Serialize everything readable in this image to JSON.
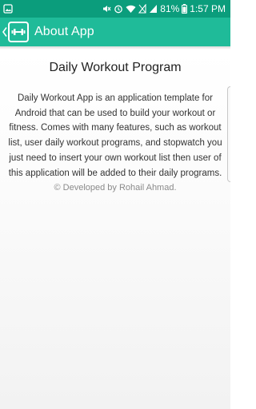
{
  "status_bar": {
    "battery_percent": "81%",
    "time": "1:57 PM",
    "icons": [
      "gallery-notification-icon",
      "mute-icon",
      "alarm-icon",
      "wifi-icon",
      "silent-signal-icon",
      "cellular-signal-icon",
      "battery-icon"
    ]
  },
  "app_bar": {
    "title": "About App",
    "icon": "dumbbell-icon",
    "background": "#1fbb99"
  },
  "content": {
    "title": "Daily Workout Program",
    "description": "Daily Workout App is an application template for Android that can be used to build your workout or fitness. Comes with many features, such as workout list, user daily workout programs, and stopwatch you just need to insert your own workout list then user of this application will be added to their daily programs.",
    "credit": "© Developed by Rohail Ahmad."
  },
  "colors": {
    "status_bar": "#0b9d7c",
    "accent": "#1fbb99"
  }
}
